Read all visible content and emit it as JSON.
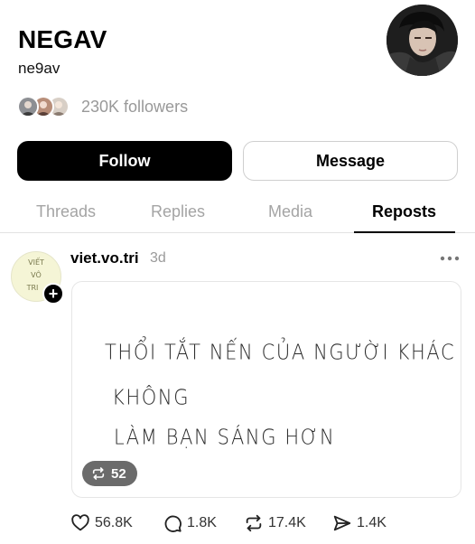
{
  "profile": {
    "name": "NEGAV",
    "handle": "ne9av",
    "followers_text": "230K followers",
    "follow_label": "Follow",
    "message_label": "Message"
  },
  "tabs": [
    {
      "label": "Threads",
      "active": false
    },
    {
      "label": "Replies",
      "active": false
    },
    {
      "label": "Media",
      "active": false
    },
    {
      "label": "Reposts",
      "active": true
    }
  ],
  "post": {
    "author": "viet.vo.tri",
    "time": "3d",
    "avatar_text": [
      "VIẾT",
      "VÔ",
      "TRI"
    ],
    "image_text": [
      "THỔI TẮT NẾN CỦA NGƯỜI KHÁC",
      "KHÔNG",
      "LÀM BẠN SÁNG HƠN"
    ],
    "image_reposts": "52",
    "likes": "56.8K",
    "replies": "1.8K",
    "reposts": "17.4K",
    "shares": "1.4K"
  },
  "colors": {
    "primary_button_bg": "#000000",
    "muted_text": "#999999",
    "tab_inactive": "#a4a4a4"
  }
}
